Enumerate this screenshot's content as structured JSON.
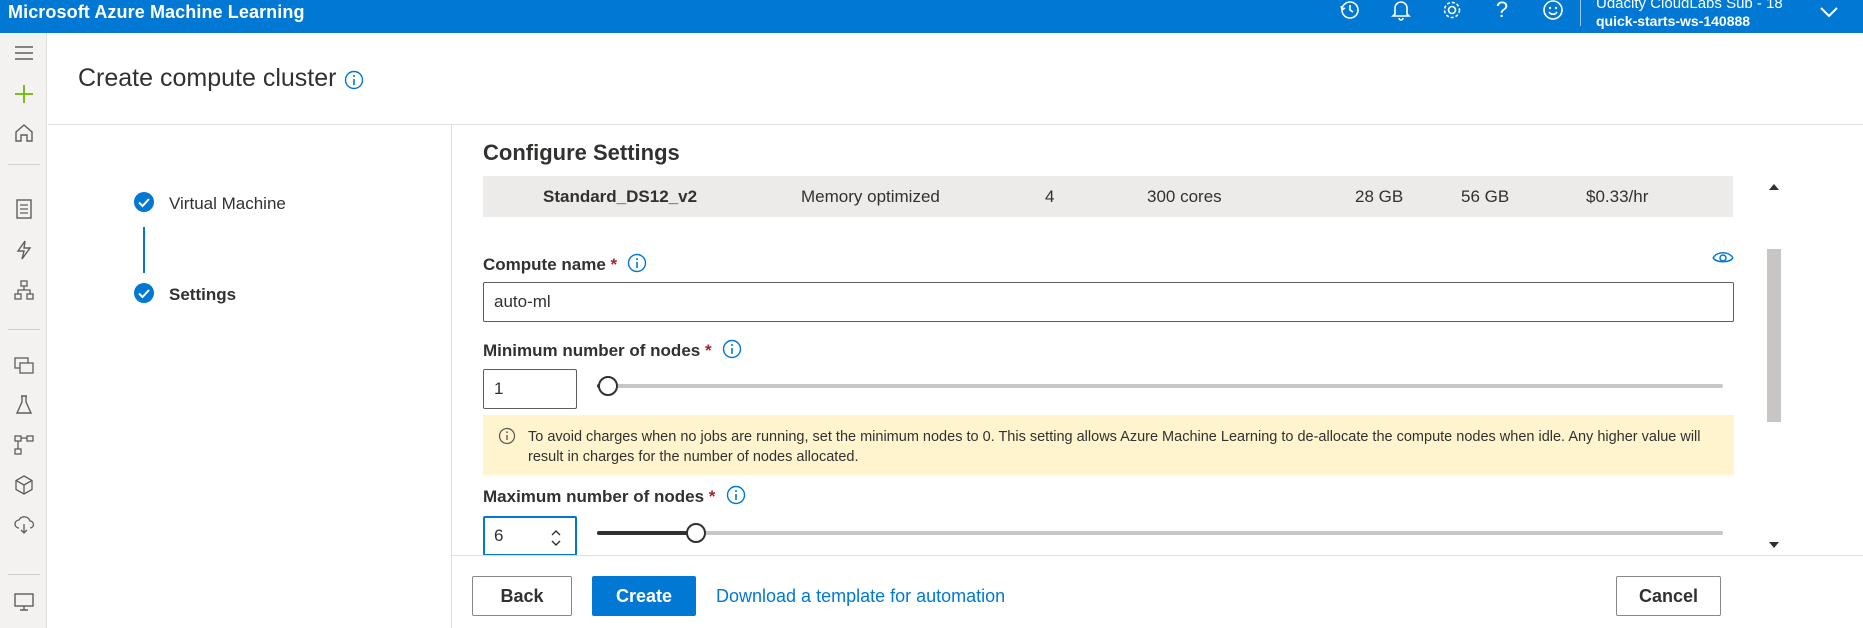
{
  "app": {
    "title": "Microsoft Azure Machine Learning",
    "account_subscription": "Udacity CloudLabs Sub - 18",
    "account_workspace": "quick-starts-ws-140888",
    "topbar_icons": [
      "history-icon",
      "bell-icon",
      "gear-icon",
      "help-icon",
      "feedback-smiley-icon",
      "chevron-down-icon"
    ]
  },
  "rail": {
    "icons": [
      "hamburger-icon",
      "plus-icon",
      "home-icon",
      "notebook-icon",
      "automl-icon",
      "designer-icon",
      "datasets-icon",
      "experiments-icon",
      "pipelines-icon",
      "models-icon",
      "endpoints-icon",
      "compute-icon"
    ]
  },
  "page": {
    "title": "Create compute cluster"
  },
  "steps": [
    {
      "label": "Virtual Machine",
      "status": "complete"
    },
    {
      "label": "Settings",
      "status": "complete",
      "active": true
    }
  ],
  "settings": {
    "section_title": "Configure Settings",
    "selected_vm": {
      "name": "Standard_DS12_v2",
      "category": "Memory optimized",
      "workload_cores": "4",
      "available_quota": "300 cores",
      "ram": "28 GB",
      "storage": "56 GB",
      "cost": "$0.33/hr"
    },
    "compute_name": {
      "label": "Compute name",
      "required_mark": "*",
      "value": "auto-ml"
    },
    "min_nodes": {
      "label": "Minimum number of nodes",
      "required_mark": "*",
      "value": "1",
      "slider_fraction": 0.0
    },
    "warning": {
      "text": "To avoid charges when no jobs are running, set the minimum nodes to 0. This setting allows Azure Machine Learning to de-allocate the compute nodes when idle. Any higher value will result in charges for the number of nodes allocated."
    },
    "max_nodes": {
      "label": "Maximum number of nodes",
      "required_mark": "*",
      "value": "6",
      "slider_fraction": 0.08
    }
  },
  "footer": {
    "back_label": "Back",
    "create_label": "Create",
    "template_link": "Download a template for automation",
    "cancel_label": "Cancel"
  },
  "colors": {
    "brand": "#0078d4",
    "warning_bg": "#fff4ce",
    "required": "#a4262c"
  }
}
